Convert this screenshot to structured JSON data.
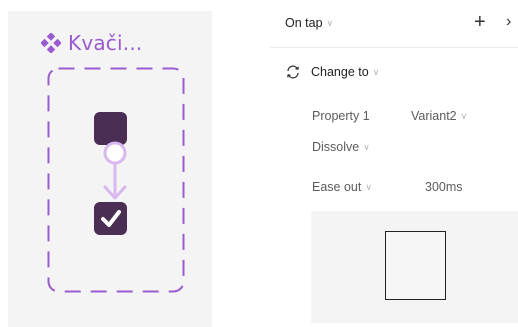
{
  "canvas": {
    "component_name": "Kvači...",
    "component_icon": "component-diamond-icon",
    "colors": {
      "accent": "#9a5bcf",
      "variant_fill": "#4b2e54",
      "connector": "#d9b8f0",
      "canvas_bg": "#f4f4f4"
    }
  },
  "panel": {
    "trigger_label": "On tap",
    "add_icon": "plus-icon",
    "more_icon": "chevron-right-icon",
    "action_label": "Change to",
    "action_icon": "swap-arrows-icon",
    "property_label": "Property 1",
    "property_value": "Variant2",
    "animation_label": "Dissolve",
    "easing_label": "Ease out",
    "duration": "300ms"
  }
}
